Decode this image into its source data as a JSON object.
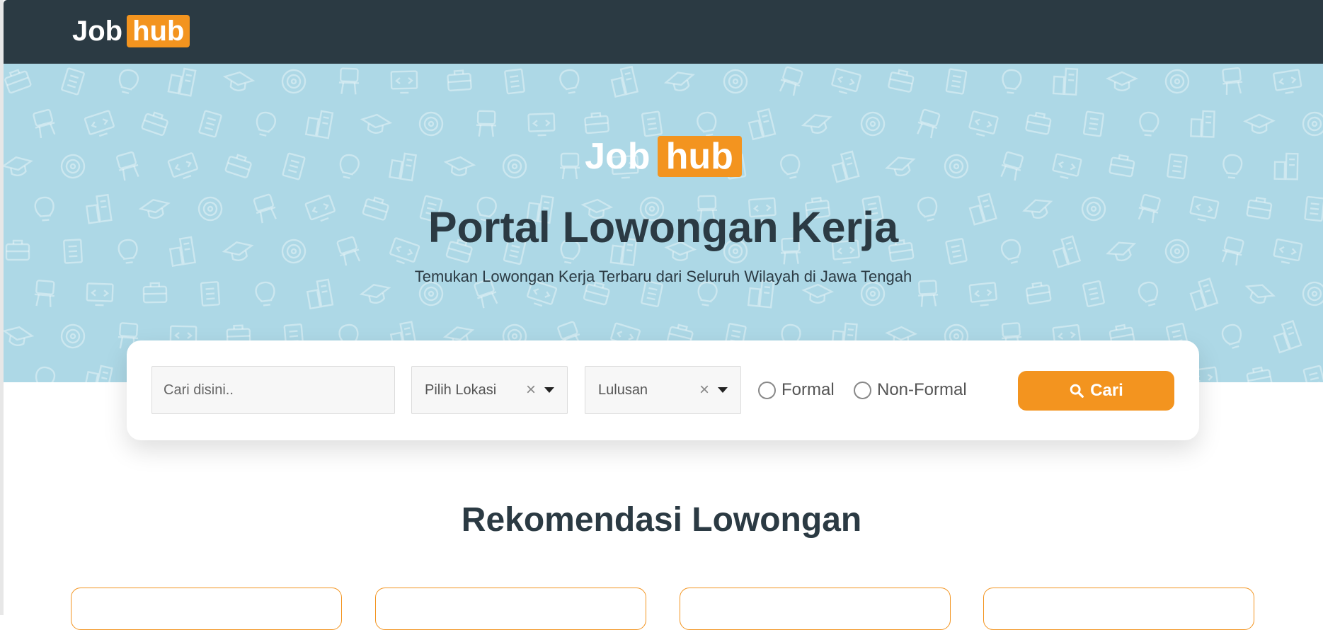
{
  "brand": {
    "part1": "Job",
    "part2": "hub"
  },
  "hero": {
    "title": "Portal Lowongan Kerja",
    "subtitle": "Temukan Lowongan Kerja Terbaru dari Seluruh Wilayah di Jawa Tengah"
  },
  "search": {
    "placeholder": "Cari disini..",
    "location": {
      "value": "Pilih Lokasi",
      "clear_icon": "×"
    },
    "graduate": {
      "value": "Lulusan",
      "clear_icon": "×"
    },
    "options": [
      {
        "label": "Formal",
        "checked": false
      },
      {
        "label": "Non-Formal",
        "checked": false
      }
    ],
    "button_label": "Cari"
  },
  "recommendation": {
    "title": "Rekomendasi Lowongan"
  },
  "colors": {
    "navbar": "#2b3a43",
    "accent": "#f3941f",
    "hero": "#add8e6"
  }
}
